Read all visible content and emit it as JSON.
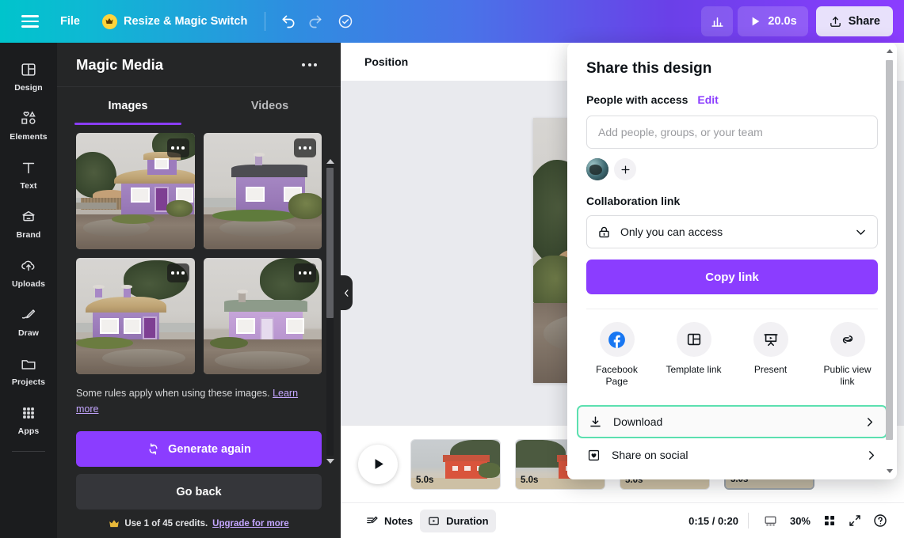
{
  "topbar": {
    "menu_icon": "hamburger-icon",
    "file_label": "File",
    "resize_label": "Resize & Magic Switch",
    "crown_icon": "crown-icon",
    "undo_icon": "undo-icon",
    "redo_icon": "redo-icon",
    "autosave_icon": "cloud-check-icon",
    "chart_icon": "analytics-icon",
    "play_icon": "play-icon",
    "duration_label": "20.0s",
    "share_label": "Share",
    "share_icon": "upload-icon",
    "gradient_from": "#00c4cc",
    "gradient_to": "#8b3dff"
  },
  "rail": {
    "items": [
      {
        "label": "Design",
        "icon": "layout-icon"
      },
      {
        "label": "Elements",
        "icon": "shapes-icon"
      },
      {
        "label": "Text",
        "icon": "text-icon"
      },
      {
        "label": "Brand",
        "icon": "brand-icon"
      },
      {
        "label": "Uploads",
        "icon": "upload-cloud-icon"
      },
      {
        "label": "Draw",
        "icon": "pen-icon"
      },
      {
        "label": "Projects",
        "icon": "folder-icon"
      },
      {
        "label": "Apps",
        "icon": "grid-apps-icon"
      }
    ]
  },
  "panel": {
    "title": "Magic Media",
    "more_icon": "more-options-icon",
    "tabs": [
      {
        "label": "Images",
        "active": true
      },
      {
        "label": "Videos",
        "active": false
      }
    ],
    "results": [
      {
        "name": "generated-image-1",
        "alt": "Purple thatched cottage with tree"
      },
      {
        "name": "generated-image-2",
        "alt": "Lavender cottage by wet road"
      },
      {
        "name": "generated-image-3",
        "alt": "Lilac thatched cottage with hedge"
      },
      {
        "name": "generated-image-4",
        "alt": "Pink-purple cottage with green roof"
      }
    ],
    "rules_text": "Some rules apply when using these images.",
    "rules_link": "Learn more",
    "generate_label": "Generate again",
    "generate_icon": "refresh-icon",
    "go_back_label": "Go back",
    "credits_icon": "crown-icon",
    "credits_text": "Use 1 of 45 credits.",
    "credits_link": "Upgrade for more",
    "accent_color": "#8b3dff"
  },
  "editor": {
    "position_label": "Position",
    "collapse_icon": "chevron-left-icon",
    "canvas_alt": "Purple thatched cottage on a wet lane"
  },
  "timeline": {
    "play_icon": "play-icon",
    "pages": [
      {
        "duration": "5.0s",
        "selected": false
      },
      {
        "duration": "5.0s",
        "selected": false
      },
      {
        "duration": "5.0s",
        "selected": false
      },
      {
        "duration": "5.0s",
        "selected": true
      }
    ]
  },
  "bottombar": {
    "notes_label": "Notes",
    "notes_icon": "notes-icon",
    "duration_label": "Duration",
    "duration_icon": "duration-icon",
    "time_display": "0:15 / 0:20",
    "pages_icon": "page-view-icon",
    "zoom_level": "30%",
    "grid_icon": "grid-view-icon",
    "fullscreen_icon": "expand-icon",
    "help_icon": "help-icon"
  },
  "share_dialog": {
    "title": "Share this design",
    "people_label": "People with access",
    "edit_label": "Edit",
    "people_placeholder": "Add people, groups, or your team",
    "avatar_name": "user-avatar",
    "add_person_icon": "plus-icon",
    "collab_label": "Collaboration link",
    "access_value": "Only you can access",
    "lock_icon": "lock-icon",
    "chevron_icon": "chevron-down-icon",
    "copy_label": "Copy link",
    "quick_actions": [
      {
        "label": "Facebook Page",
        "icon": "facebook-icon"
      },
      {
        "label": "Template link",
        "icon": "template-icon"
      },
      {
        "label": "Present",
        "icon": "present-icon"
      },
      {
        "label": "Public view link",
        "icon": "link-icon"
      }
    ],
    "menu_rows": [
      {
        "label": "Download",
        "icon": "download-icon",
        "highlighted": true
      },
      {
        "label": "Share on social",
        "icon": "social-icon",
        "highlighted": false
      }
    ],
    "highlight_color": "#5ce0b0",
    "primary_color": "#8b3dff"
  }
}
